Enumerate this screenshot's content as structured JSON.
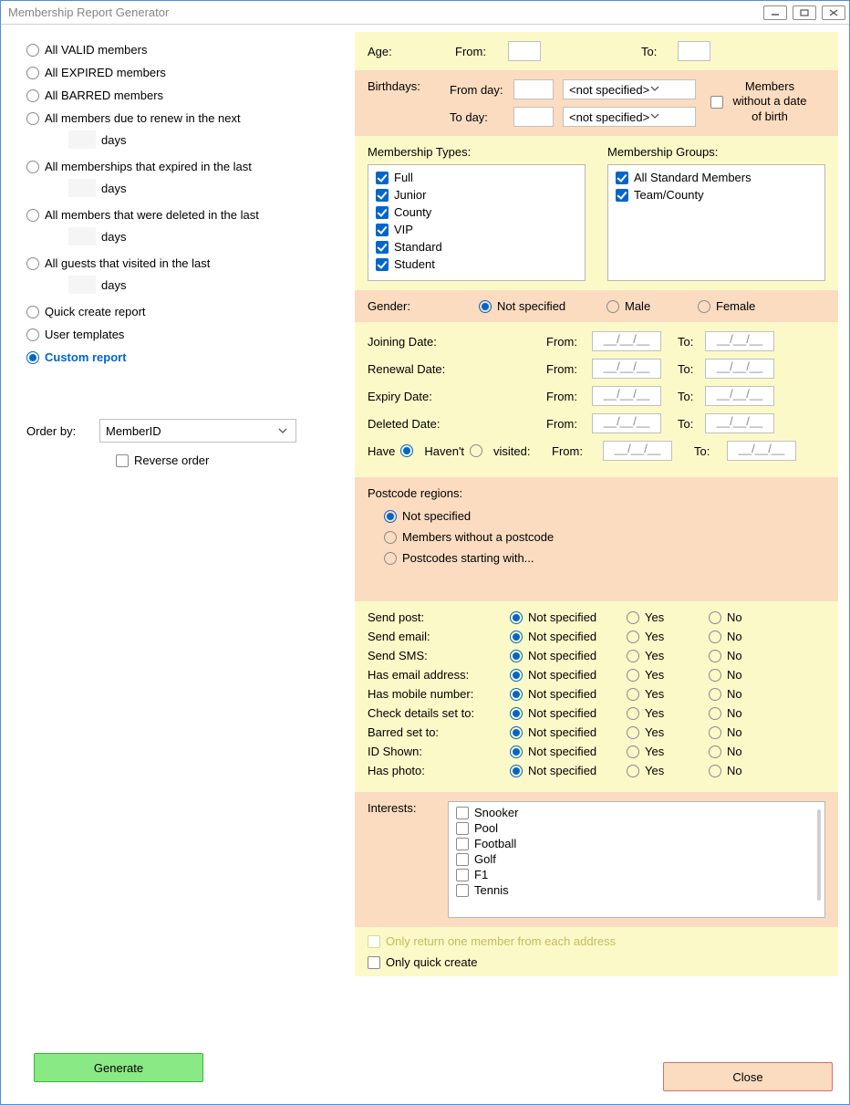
{
  "window": {
    "title": "Membership Report Generator"
  },
  "leftPanel": {
    "options": [
      {
        "label": "All VALID members"
      },
      {
        "label": "All EXPIRED members"
      },
      {
        "label": "All BARRED members"
      },
      {
        "label": "All members due to renew in the next",
        "days": true
      },
      {
        "label": "All memberships that expired in the last",
        "days": true
      },
      {
        "label": "All members that were deleted in the last",
        "days": true
      },
      {
        "label": "All guests that visited in the last",
        "days": true
      },
      {
        "label": "Quick create report"
      },
      {
        "label": "User templates"
      },
      {
        "label": "Custom report",
        "selected": true
      }
    ],
    "days_label": "days",
    "order_by_label": "Order by:",
    "order_by_value": "MemberID",
    "reverse_label": "Reverse order"
  },
  "age": {
    "label": "Age:",
    "from_label": "From:",
    "to_label": "To:"
  },
  "birthdays": {
    "label": "Birthdays:",
    "from_day": "From day:",
    "to_day": "To day:",
    "not_specified": "<not specified>",
    "members_without_dob": "Members without a date of birth"
  },
  "types": {
    "head": "Membership Types:",
    "items": [
      "Full",
      "Junior",
      "County",
      "VIP",
      "Standard",
      "Student"
    ]
  },
  "groups": {
    "head": "Membership Groups:",
    "items": [
      "All Standard Members",
      "Team/County"
    ]
  },
  "gender": {
    "label": "Gender:",
    "opts": [
      "Not specified",
      "Male",
      "Female"
    ]
  },
  "dateRows": [
    {
      "label": "Joining Date:"
    },
    {
      "label": "Renewal Date:"
    },
    {
      "label": "Expiry Date:"
    },
    {
      "label": "Deleted Date:"
    }
  ],
  "dateCommon": {
    "from": "From:",
    "to": "To:",
    "placeholder": "__/__/__"
  },
  "visited": {
    "have": "Have",
    "havent": "Haven't",
    "visited": "visited:"
  },
  "postcode": {
    "head": "Postcode regions:",
    "opts": [
      "Not specified",
      "Members without a postcode",
      "Postcodes starting with..."
    ]
  },
  "prefs": {
    "labels": [
      "Send post:",
      "Send email:",
      "Send SMS:",
      "Has email address:",
      "Has mobile number:",
      "Check details set to:",
      "Barred set to:",
      "ID Shown:",
      "Has photo:"
    ],
    "opts": [
      "Not specified",
      "Yes",
      "No"
    ]
  },
  "interests": {
    "label": "Interests:",
    "items": [
      "Snooker",
      "Pool",
      "Football",
      "Golf",
      "F1",
      "Tennis"
    ]
  },
  "bottom": {
    "one_per_address": "Only return one member from each address",
    "quick_create": "Only quick create"
  },
  "buttons": {
    "generate": "Generate",
    "close": "Close"
  }
}
